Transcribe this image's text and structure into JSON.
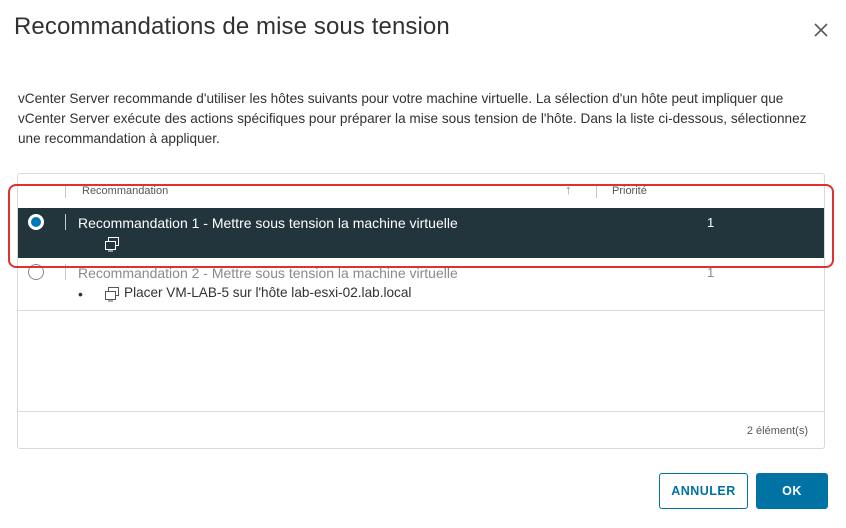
{
  "dialog": {
    "title": "Recommandations de mise sous tension",
    "description": "vCenter Server recommande d'utiliser les hôtes suivants pour votre machine virtuelle. La sélection d'un hôte peut impliquer que vCenter Server exécute des actions spécifiques pour préparer la mise sous tension de l'hôte. Dans la liste ci-dessous, sélectionnez une recommandation à appliquer."
  },
  "grid": {
    "columns": {
      "recommendation": "Recommandation",
      "priority": "Priorité"
    },
    "sort_indicator": "↑",
    "rows": [
      {
        "selected": true,
        "label": "Recommandation 1 - Mettre sous tension la machine virtuelle",
        "priority": "1",
        "detail_icon": "vm-icon"
      },
      {
        "selected": false,
        "label": "Recommandation 2 - Mettre sous tension la machine virtuelle",
        "priority": "1",
        "detail_bullet": "•",
        "detail_icon": "vm-icon",
        "detail_text": "Placer VM-LAB-5 sur l'hôte lab-esxi-02.lab.local"
      }
    ],
    "footer_count": "2 élément(s)"
  },
  "buttons": {
    "cancel": "ANNULER",
    "ok": "OK"
  },
  "colors": {
    "selected_row": "#22343c",
    "primary": "#0072a3",
    "radio_accent": "#0079b8",
    "highlight_box": "#e03131"
  }
}
